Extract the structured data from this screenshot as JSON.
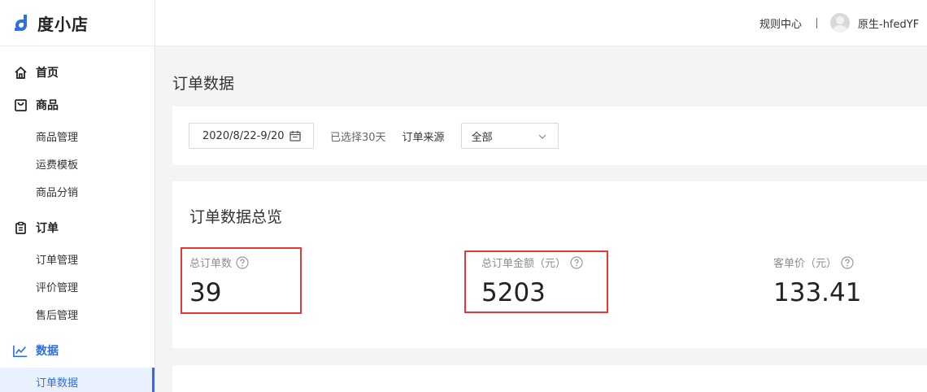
{
  "app": {
    "name": "度小店"
  },
  "header": {
    "rule_center": "规则中心",
    "user_name": "原生-hfedYF"
  },
  "sidebar": {
    "home": "首页",
    "goods": {
      "label": "商品",
      "items": [
        "商品管理",
        "运费模板",
        "商品分销"
      ]
    },
    "orders": {
      "label": "订单",
      "items": [
        "订单管理",
        "评价管理",
        "售后管理"
      ]
    },
    "data": {
      "label": "数据",
      "items": [
        "订单数据"
      ]
    }
  },
  "page": {
    "title": "订单数据"
  },
  "filters": {
    "date_range": "2020/8/22-9/20",
    "range_note": "已选择30天",
    "source_label": "订单来源",
    "source_value": "全部"
  },
  "overview": {
    "title": "订单数据总览",
    "metrics": [
      {
        "label": "总订单数",
        "value": "39"
      },
      {
        "label": "总订单金额（元）",
        "value": "5203"
      },
      {
        "label": "客单价（元）",
        "value": "133.41"
      }
    ]
  },
  "colors": {
    "accent": "#2d6ee6",
    "highlight": "#e53935"
  }
}
